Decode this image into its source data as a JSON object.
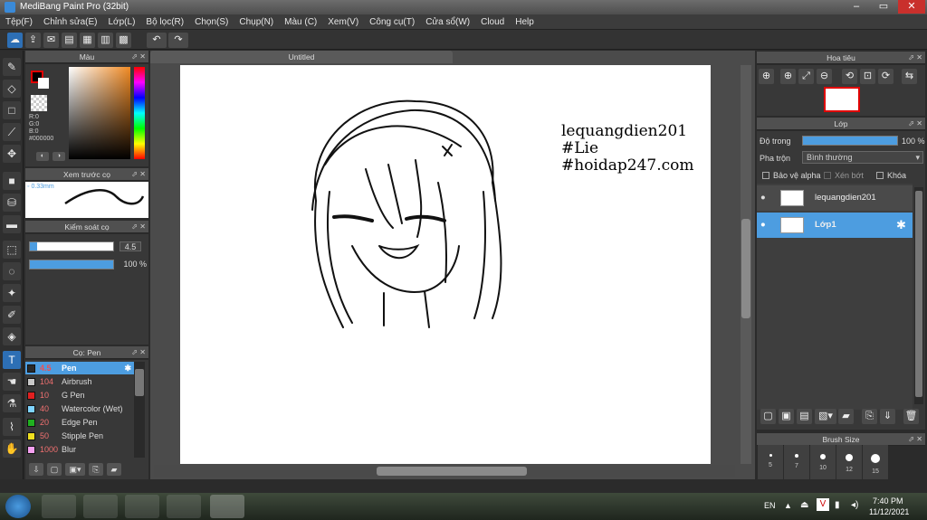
{
  "window": {
    "title": "MediBang Paint Pro (32bit)",
    "minimize": "–",
    "maximize": "▭",
    "close": "✕"
  },
  "menu": [
    "Tệp(F)",
    "Chỉnh sửa(E)",
    "Lớp(L)",
    "Bộ lọc(R)",
    "Chọn(S)",
    "Chụp(N)",
    "Màu (C)",
    "Xem(V)",
    "Công cụ(T)",
    "Cửa sổ(W)",
    "Cloud",
    "Help"
  ],
  "color_panel": {
    "title": "Màu",
    "r": "R:0",
    "g": "G:0",
    "b": "B:0",
    "hex": "#000000"
  },
  "brush_preview": {
    "title": "Xem trước cọ",
    "size": "0.33mm"
  },
  "brush_control": {
    "title": "Kiểm soát cọ",
    "size_value": "4.5",
    "opacity_value": "100 %",
    "size_fraction": 0.92,
    "opacity_fraction": 1.0
  },
  "brush_panel": {
    "title": "Cọ: Pen",
    "items": [
      {
        "size": "4.5",
        "name": "Pen",
        "color": "#2a2a2a",
        "selected": true
      },
      {
        "size": "104",
        "name": "Airbrush",
        "color": "#c8c8c8"
      },
      {
        "size": "10",
        "name": "G Pen",
        "color": "#e02020"
      },
      {
        "size": "40",
        "name": "Watercolor (Wet)",
        "color": "#7fd4ff"
      },
      {
        "size": "20",
        "name": "Edge Pen",
        "color": "#20b020"
      },
      {
        "size": "50",
        "name": "Stipple Pen",
        "color": "#f0e020"
      },
      {
        "size": "1000",
        "name": "Blur",
        "color": "#f5a0f0"
      }
    ]
  },
  "canvas": {
    "tab_title": "Untitled",
    "signature": [
      "lequangdien201",
      "#Lie",
      "#hoidap247.com"
    ]
  },
  "navigator": {
    "title": "Hoa tiêu"
  },
  "layers": {
    "title": "Lớp",
    "opacity_label": "Độ trong",
    "opacity_value": "100 %",
    "blend_label": "Pha trộn",
    "blend_value": "Bình thường",
    "protect_alpha": "Bảo vệ alpha",
    "clipping": "Xén bớt",
    "lock": "Khóa",
    "items": [
      {
        "name": "lequangdien201",
        "selected": false
      },
      {
        "name": "Lớp1",
        "selected": true
      }
    ]
  },
  "brush_size": {
    "title": "Brush Size",
    "sizes": [
      "5",
      "7",
      "10",
      "12",
      "15"
    ]
  },
  "taskbar": {
    "lang": "EN",
    "time": "7:40 PM",
    "date": "11/12/2021"
  },
  "colors": {
    "accent": "#4d9de0",
    "panel": "#383838",
    "bg": "#2b2b2b"
  }
}
